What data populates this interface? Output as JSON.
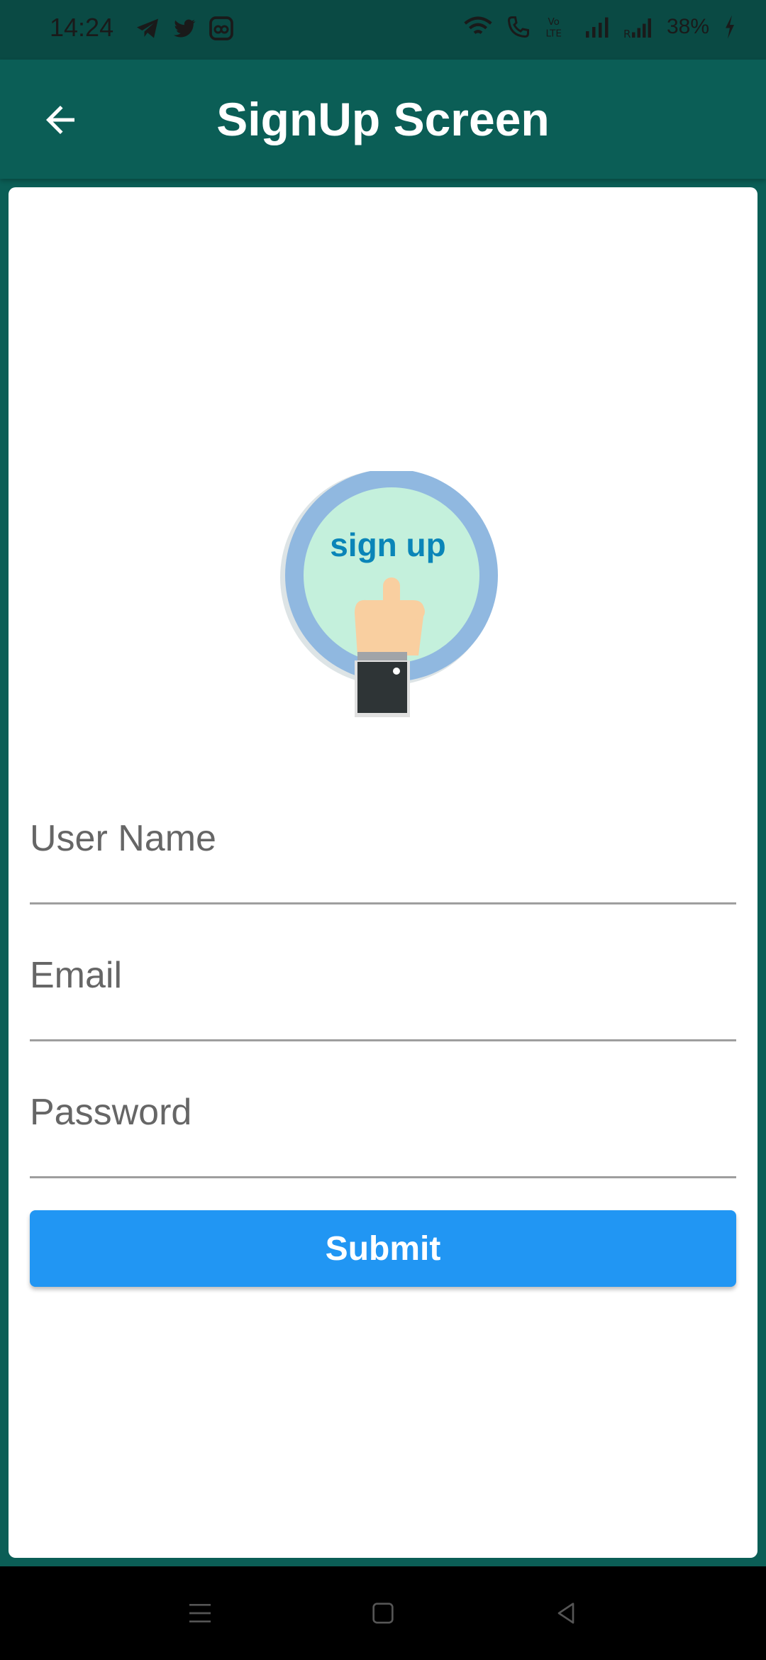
{
  "status_bar": {
    "time": "14:24",
    "battery": "38%",
    "left_icons": [
      "telegram-icon",
      "twitter-icon",
      "app-icon"
    ],
    "right_icons": [
      "wifi-icon",
      "wifi-call-icon",
      "volte-icon",
      "signal-icon",
      "signal-r-icon",
      "charging-icon"
    ]
  },
  "app_bar": {
    "title": "SignUp Screen",
    "back_icon": "arrow-back-icon",
    "background": "#0b5e56"
  },
  "hero_image": {
    "text": "sign up",
    "icon": "signup-hand-icon"
  },
  "form": {
    "username_placeholder": "User Name",
    "username_value": "",
    "email_placeholder": "Email",
    "email_value": "",
    "password_placeholder": "Password",
    "password_value": "",
    "submit_label": "Submit",
    "submit_color": "#2196f3"
  },
  "nav_bar": {
    "items": [
      "menu-icon",
      "home-icon",
      "back-icon"
    ]
  }
}
